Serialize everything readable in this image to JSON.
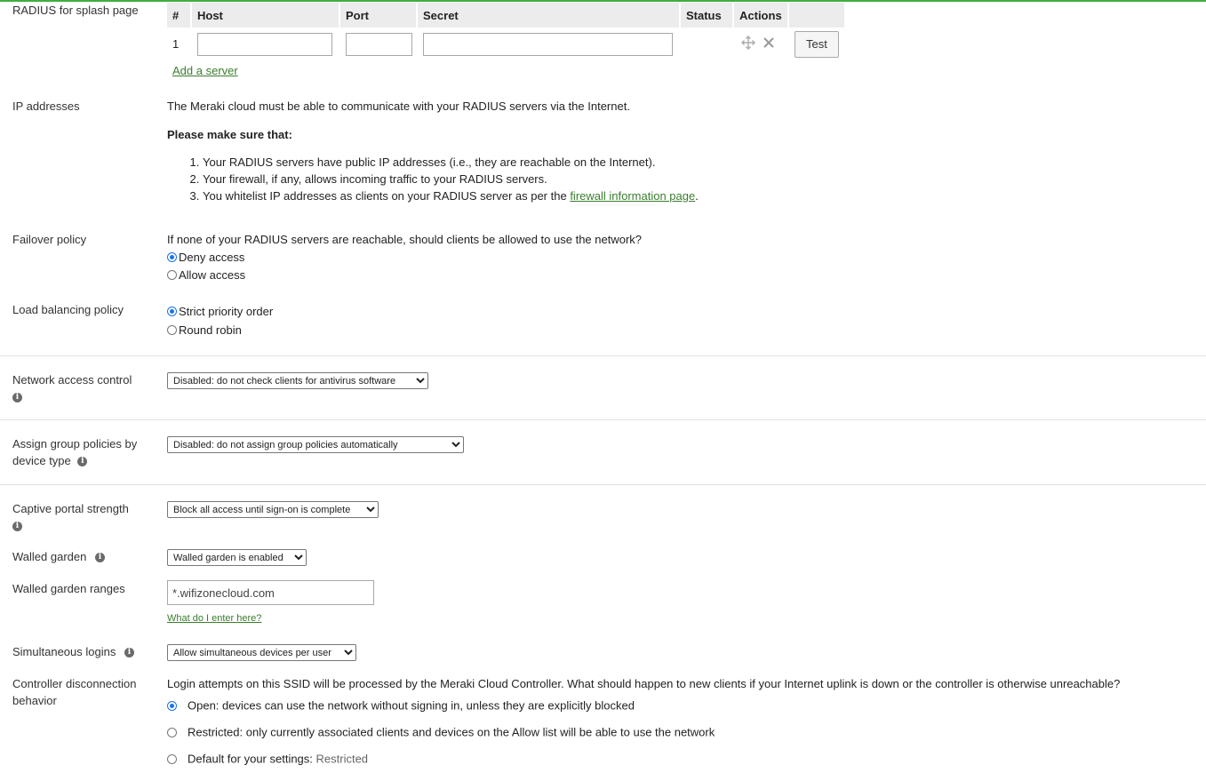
{
  "radius_splash": {
    "label": "RADIUS for splash page",
    "headers": [
      "#",
      "Host",
      "Port",
      "Secret",
      "Status",
      "Actions"
    ],
    "rows": [
      {
        "num": "1",
        "host": "",
        "port": "",
        "secret": "",
        "status": ""
      }
    ],
    "test_label": "Test",
    "add_server": "Add a server"
  },
  "ip_addresses": {
    "label": "IP addresses",
    "intro": "The Meraki cloud must be able to communicate with your RADIUS servers via the Internet.",
    "make_sure": "Please make sure that:",
    "items": [
      "Your RADIUS servers have public IP addresses (i.e., they are reachable on the Internet).",
      "Your firewall, if any, allows incoming traffic to your RADIUS servers."
    ],
    "item3_prefix": "You whitelist IP addresses as clients on your RADIUS server as per the ",
    "item3_link": "firewall information page",
    "item3_suffix": "."
  },
  "failover": {
    "label": "Failover policy",
    "question": "If none of your RADIUS servers are reachable, should clients be allowed to use the network?",
    "options": [
      "Deny access",
      "Allow access"
    ],
    "selected": 0
  },
  "load_balancing": {
    "label": "Load balancing policy",
    "options": [
      "Strict priority order",
      "Round robin"
    ],
    "selected": 0
  },
  "nac": {
    "label": "Network access control",
    "value": "Disabled: do not check clients for antivirus software"
  },
  "group_policies": {
    "label_line1": "Assign group policies by",
    "label_line2": "device type",
    "value": "Disabled: do not assign group policies automatically"
  },
  "captive": {
    "label": "Captive portal strength",
    "value": "Block all access until sign-on is complete"
  },
  "walled_garden": {
    "label": "Walled garden",
    "value": "Walled garden is enabled"
  },
  "walled_ranges": {
    "label": "Walled garden ranges",
    "value": "*.wifizonecloud.com",
    "help_link": "What do I enter here?"
  },
  "simultaneous": {
    "label": "Simultaneous logins",
    "value": "Allow simultaneous devices per user"
  },
  "controller": {
    "label_line1": "Controller disconnection",
    "label_line2": "behavior",
    "question": "Login attempts on this SSID will be processed by the Meraki Cloud Controller. What should happen to new clients if your Internet uplink is down or the controller is otherwise unreachable?",
    "options": [
      "Open: devices can use the network without signing in, unless they are explicitly blocked",
      "Restricted: only currently associated clients and devices on the Allow list will be able to use the network"
    ],
    "default_prefix": "Default for your settings: ",
    "default_value": "Restricted",
    "selected": 0
  },
  "colors": {
    "accent": "#3fae3f",
    "link": "#3a7d2e",
    "radio": "#1a73e8"
  }
}
